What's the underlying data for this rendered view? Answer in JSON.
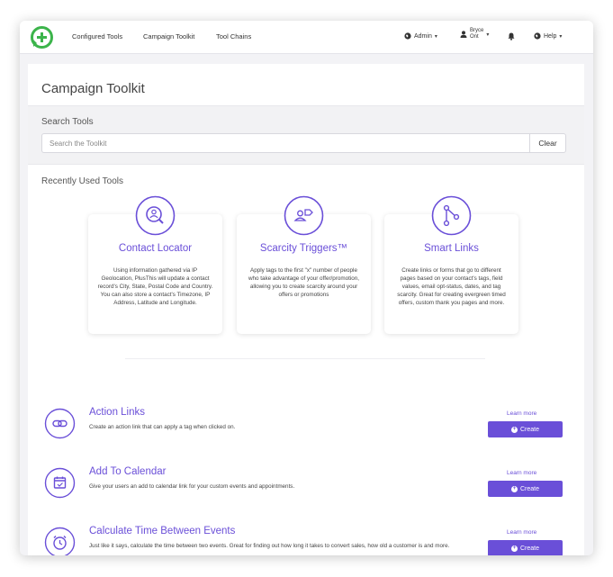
{
  "nav": {
    "links": [
      "Configured Tools",
      "Campaign Toolkit",
      "Tool Chains"
    ],
    "admin_label": "Admin",
    "user_first": "Bryce",
    "user_last": "Ont",
    "help_label": "Help"
  },
  "page": {
    "title": "Campaign Toolkit"
  },
  "search": {
    "label": "Search Tools",
    "placeholder": "Search the Toolkit",
    "clear_label": "Clear"
  },
  "recent": {
    "title": "Recently Used Tools",
    "cards": [
      {
        "title": "Contact Locator",
        "icon": "location-person-icon",
        "description": "Using information gathered via IP Geolocation, PlusThis will update a contact record's City, State, Postal Code and Country. You can also store a contact's Timezone, IP Address, Latitude and Longitude."
      },
      {
        "title": "Scarcity Triggers™",
        "icon": "person-tag-icon",
        "description": "Apply tags to the first \"x\" number of people who take advantage of your offer/promotion, allowing you to create scarcity around your offers or promotions"
      },
      {
        "title": "Smart Links",
        "icon": "share-nodes-icon",
        "description": "Create links or forms that go to different pages based on your contact's tags, field values, email opt-status, dates, and tag scarcity. Great for creating evergreen timed offers, custom thank you pages and more."
      }
    ]
  },
  "tools": [
    {
      "title": "Action Links",
      "icon": "link-icon",
      "description": "Create an action link that can apply a tag when clicked on.",
      "learn_more": "Learn more",
      "create_label": "Create"
    },
    {
      "title": "Add To Calendar",
      "icon": "calendar-icon",
      "description": "Give your users an add to calendar link for your custom events and appointments.",
      "learn_more": "Learn more",
      "create_label": "Create"
    },
    {
      "title": "Calculate Time Between Events",
      "icon": "alarm-clock-icon",
      "description": "Just like it says, calculate the time between two events. Great for finding out how long it takes to convert sales, how old a customer is and more.",
      "learn_more": "Learn more",
      "create_label": "Create"
    }
  ],
  "colors": {
    "accent": "#6a4fd8",
    "logo_green": "#3cb44b"
  }
}
